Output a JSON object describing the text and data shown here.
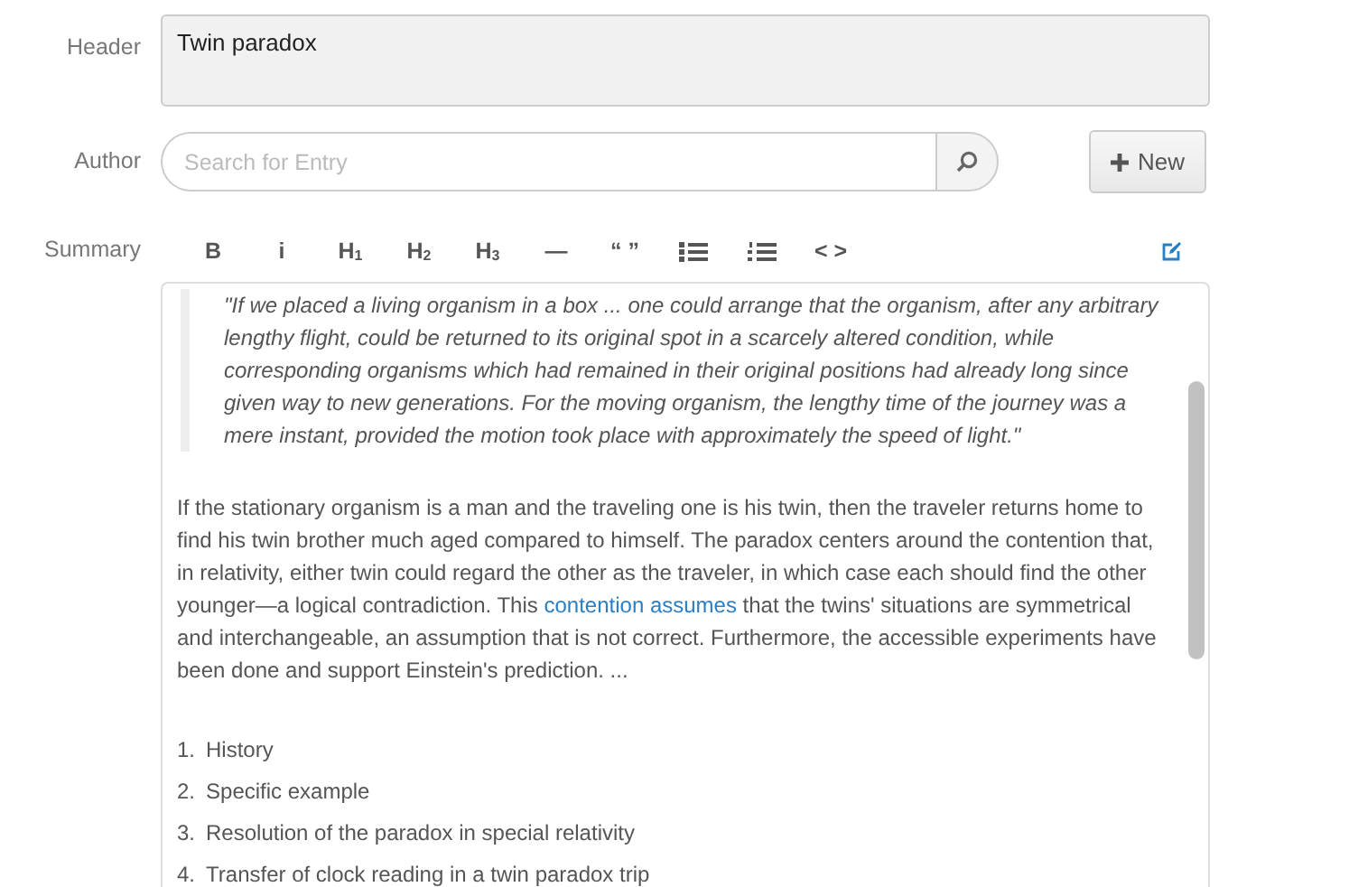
{
  "header": {
    "label": "Header",
    "value": "Twin paradox"
  },
  "author": {
    "label": "Author",
    "placeholder": "Search for Entry",
    "new_button": "New"
  },
  "summary": {
    "label": "Summary",
    "toolbar": [
      {
        "kind": "text",
        "text": "B"
      },
      {
        "kind": "text",
        "text": "i"
      },
      {
        "kind": "text",
        "text": "H$_{1}$"
      },
      {
        "kind": "text",
        "text": "H$_{2}$"
      },
      {
        "kind": "text",
        "text": "H$_{3}$"
      },
      {
        "kind": "text",
        "text": "—"
      },
      {
        "kind": "text",
        "text": "“ ”"
      },
      {
        "kind": "bullets"
      },
      {
        "kind": "numbers"
      },
      {
        "kind": "text",
        "text": "< >"
      }
    ],
    "quote": "\"If we placed a living organism in a box ... one could arrange that the organism, after any arbitrary lengthy flight, could be returned to its original spot in a scarcely altered condition, while corresponding organisms which had remained in their original positions had already long since given way to new generations. For the moving organism, the lengthy time of the journey was a mere instant, provided the motion took place with approximately the speed of light.\"",
    "paragraph": {
      "before": "If the stationary organism is a man and the traveling one is his twin, then the traveler returns home to find his twin brother much aged compared to himself. The paradox centers around the contention that, in relativity, either twin could regard the other as the traveler, in which case each should find the other younger—a logical contradiction. This ",
      "link": "contention assumes",
      "after": " that the twins' situations are symmetrical and interchangeable, an assumption that is not correct. Furthermore, the accessible experiments have been done and support Einstein's prediction. ..."
    },
    "list": [
      {
        "number": "1.",
        "text": "History"
      },
      {
        "number": "2.",
        "text": "Specific example"
      },
      {
        "number": "3.",
        "text": "Resolution of the paradox in special relativity"
      },
      {
        "number": "4.",
        "text": "Transfer of clock reading in a twin paradox trip"
      }
    ]
  }
}
